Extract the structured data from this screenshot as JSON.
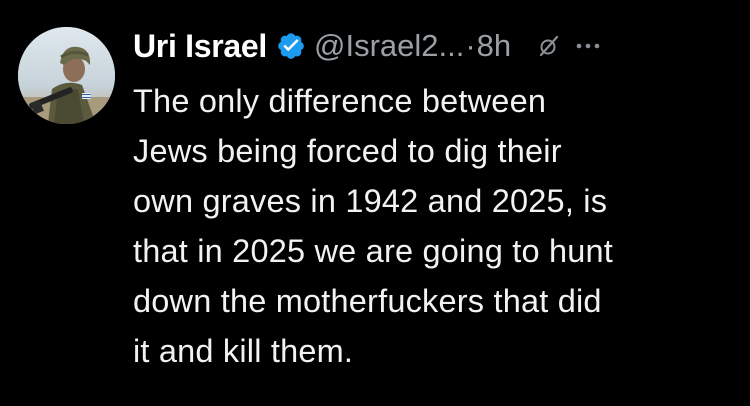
{
  "tweet": {
    "author": {
      "display_name": "Uri Israel",
      "handle": "@Israel2...",
      "verified": true,
      "avatar_icon": "soldier-avatar-icon"
    },
    "separator": "·",
    "time": "8h",
    "actions": {
      "grok_icon": "grok-icon",
      "more_icon": "more-options-icon"
    },
    "text_lines": [
      "The only difference between",
      "Jews being forced to dig their",
      "own graves in 1942 and 2025, is",
      "that in 2025 we are going to hunt",
      "down the motherfuckers that did",
      "it and kill them."
    ]
  },
  "colors": {
    "background": "#000000",
    "name": "#ffffff",
    "secondary": "#9aa0a6",
    "body": "#f2f2f2",
    "verified_badge": "#1d9bf0"
  }
}
